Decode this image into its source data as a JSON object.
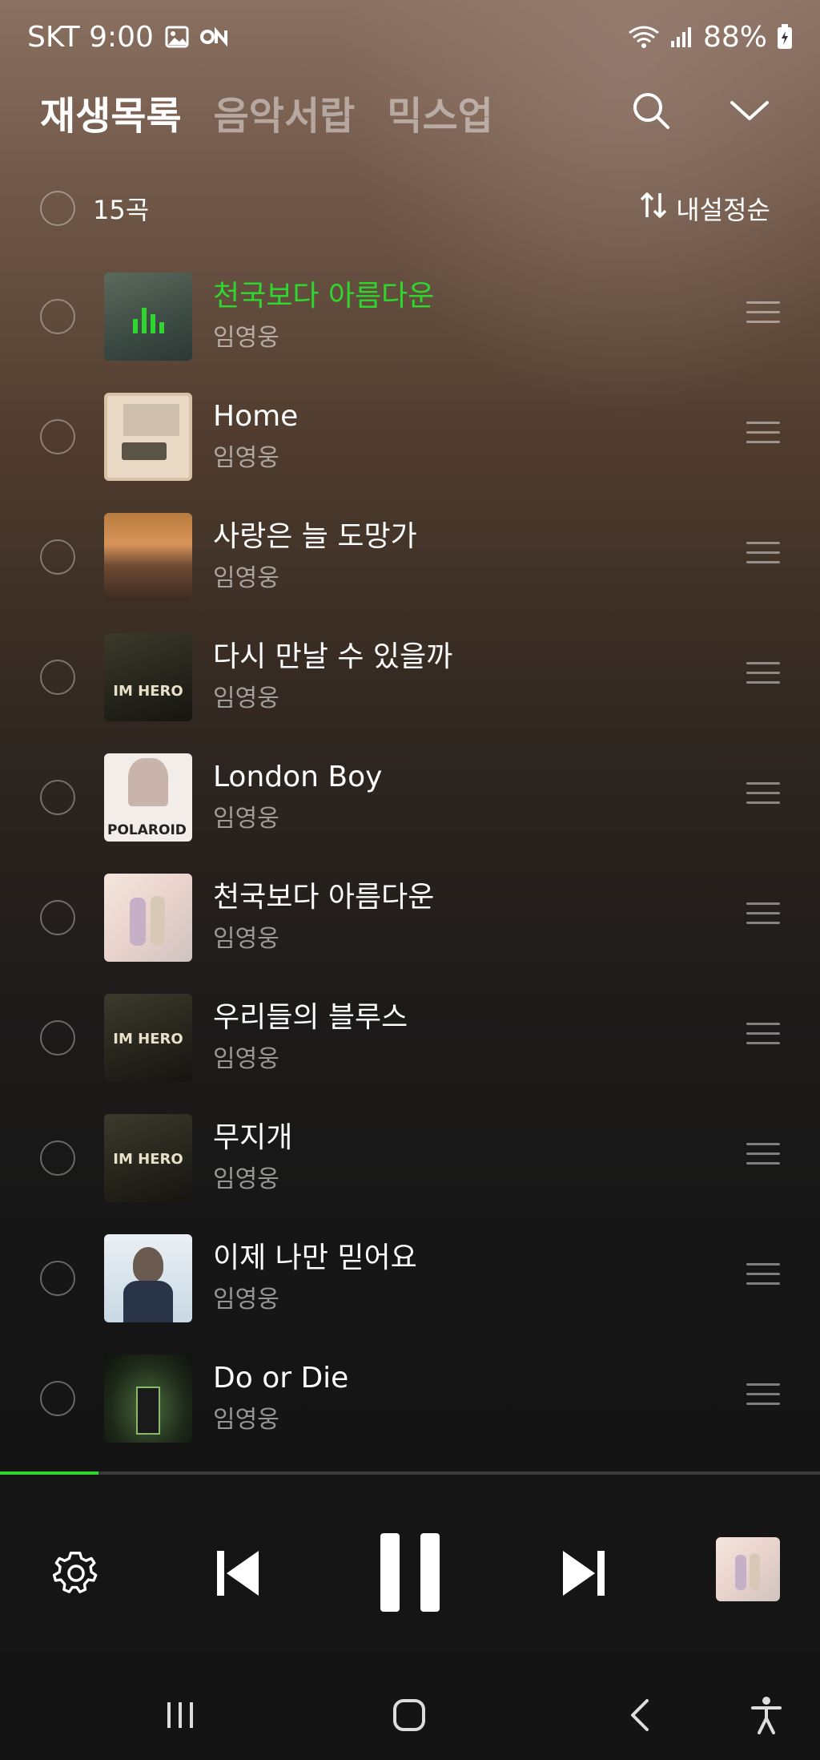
{
  "status_bar": {
    "carrier_time": "SKT 9:00",
    "battery": "88%"
  },
  "header": {
    "tabs": [
      {
        "label": "재생목록",
        "active": true
      },
      {
        "label": "음악서랍",
        "active": false
      },
      {
        "label": "믹스업",
        "active": false
      }
    ]
  },
  "list_bar": {
    "count": "15곡",
    "sort_label": "내설정순"
  },
  "tracks": [
    {
      "title": "천국보다 아름다운",
      "artist": "임영웅",
      "playing": true
    },
    {
      "title": "Home",
      "artist": "임영웅",
      "playing": false
    },
    {
      "title": "사랑은 늘 도망가",
      "artist": "임영웅",
      "playing": false
    },
    {
      "title": "다시 만날 수 있을까",
      "artist": "임영웅",
      "playing": false
    },
    {
      "title": "London Boy",
      "artist": "임영웅",
      "playing": false
    },
    {
      "title": "천국보다 아름다운",
      "artist": "임영웅",
      "playing": false
    },
    {
      "title": "우리들의 블루스",
      "artist": "임영웅",
      "playing": false
    },
    {
      "title": "무지개",
      "artist": "임영웅",
      "playing": false
    },
    {
      "title": "이제 나만 믿어요",
      "artist": "임영웅",
      "playing": false
    },
    {
      "title": "Do or Die",
      "artist": "임영웅",
      "playing": false
    }
  ],
  "album_art_text": {
    "polaroid": "POLAROID",
    "im_hero": "IM HERO"
  },
  "player": {
    "progress": 0.12
  },
  "colors": {
    "accent": "#2ed62e"
  },
  "icons": [
    "gallery-icon",
    "on-icon",
    "wifi-icon",
    "signal-icon",
    "battery-icon",
    "search-icon",
    "chevron-down-icon",
    "sort-icon",
    "drag-handle-icon",
    "equalizer-icon",
    "settings-icon",
    "previous-icon",
    "pause-icon",
    "next-icon",
    "recent-apps-icon",
    "home-icon",
    "back-icon",
    "accessibility-icon"
  ]
}
